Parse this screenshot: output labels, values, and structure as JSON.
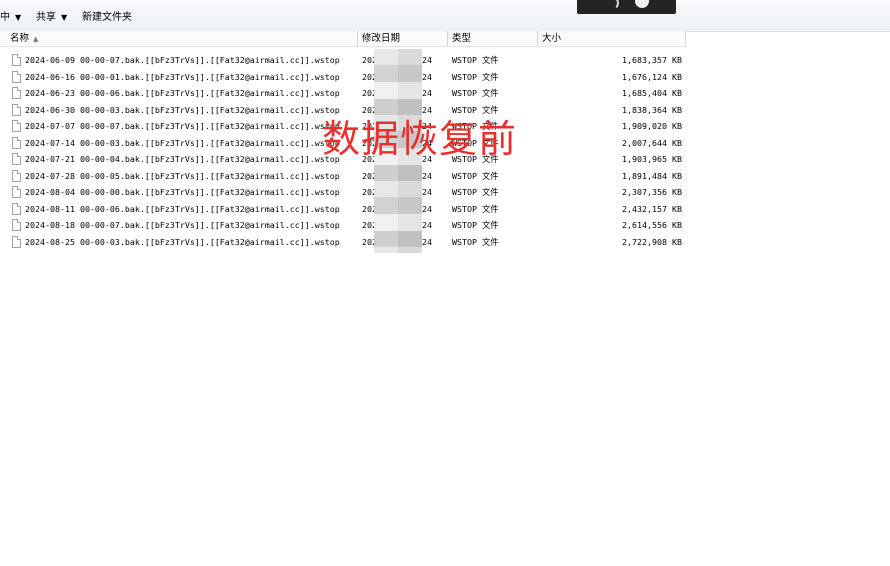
{
  "toolbar": {
    "items": [
      {
        "label": "中",
        "has_caret": true
      },
      {
        "label": "共享",
        "has_caret": true
      },
      {
        "label": "新建文件夹",
        "has_caret": false
      }
    ]
  },
  "columns": {
    "name": "名称",
    "date": "修改日期",
    "type": "类型",
    "size": "大小"
  },
  "files": [
    {
      "name": "2024-06-09 00-00-07.bak.[[bFz3TrVs]].[[Fat32@airmail.cc]].wstop",
      "date_start": "202",
      "date_end": "24",
      "type": "WSTOP 文件",
      "size": "1,683,357 KB"
    },
    {
      "name": "2024-06-16 00-00-01.bak.[[bFz3TrVs]].[[Fat32@airmail.cc]].wstop",
      "date_start": "202",
      "date_end": "24",
      "type": "WSTOP 文件",
      "size": "1,676,124 KB"
    },
    {
      "name": "2024-06-23 00-00-06.bak.[[bFz3TrVs]].[[Fat32@airmail.cc]].wstop",
      "date_start": "202",
      "date_end": "24",
      "type": "WSTOP 文件",
      "size": "1,685,404 KB"
    },
    {
      "name": "2024-06-30 00-00-03.bak.[[bFz3TrVs]].[[Fat32@airmail.cc]].wstop",
      "date_start": "202",
      "date_end": "24",
      "type": "WSTOP 文件",
      "size": "1,838,364 KB"
    },
    {
      "name": "2024-07-07 00-00-07.bak.[[bFz3TrVs]].[[Fat32@airmail.cc]].wstop",
      "date_start": "202",
      "date_end": "24",
      "type": "WSTOP 文件",
      "size": "1,909,020 KB"
    },
    {
      "name": "2024-07-14 00-00-03.bak.[[bFz3TrVs]].[[Fat32@airmail.cc]].wstop",
      "date_start": "202",
      "date_end": "24",
      "type": "WSTOP 文件",
      "size": "2,007,644 KB"
    },
    {
      "name": "2024-07-21 00-00-04.bak.[[bFz3TrVs]].[[Fat32@airmail.cc]].wstop",
      "date_start": "202",
      "date_end": "24",
      "type": "WSTOP 文件",
      "size": "1,903,965 KB"
    },
    {
      "name": "2024-07-28 00-00-05.bak.[[bFz3TrVs]].[[Fat32@airmail.cc]].wstop",
      "date_start": "202",
      "date_end": "24",
      "type": "WSTOP 文件",
      "size": "1,891,484 KB"
    },
    {
      "name": "2024-08-04 00-00-00.bak.[[bFz3TrVs]].[[Fat32@airmail.cc]].wstop",
      "date_start": "202",
      "date_end": "24",
      "type": "WSTOP 文件",
      "size": "2,307,356 KB"
    },
    {
      "name": "2024-08-11 00-00-06.bak.[[bFz3TrVs]].[[Fat32@airmail.cc]].wstop",
      "date_start": "202",
      "date_end": "24",
      "type": "WSTOP 文件",
      "size": "2,432,157 KB"
    },
    {
      "name": "2024-08-18 00-00-07.bak.[[bFz3TrVs]].[[Fat32@airmail.cc]].wstop",
      "date_start": "202",
      "date_end": "24",
      "type": "WSTOP 文件",
      "size": "2,614,556 KB"
    },
    {
      "name": "2024-08-25 00-00-03.bak.[[bFz3TrVs]].[[Fat32@airmail.cc]].wstop",
      "date_start": "202",
      "date_end": "24",
      "type": "WSTOP 文件",
      "size": "2,722,908 KB"
    }
  ],
  "watermark": "数据恢复前",
  "colors": {
    "watermark": "#e8312f"
  }
}
